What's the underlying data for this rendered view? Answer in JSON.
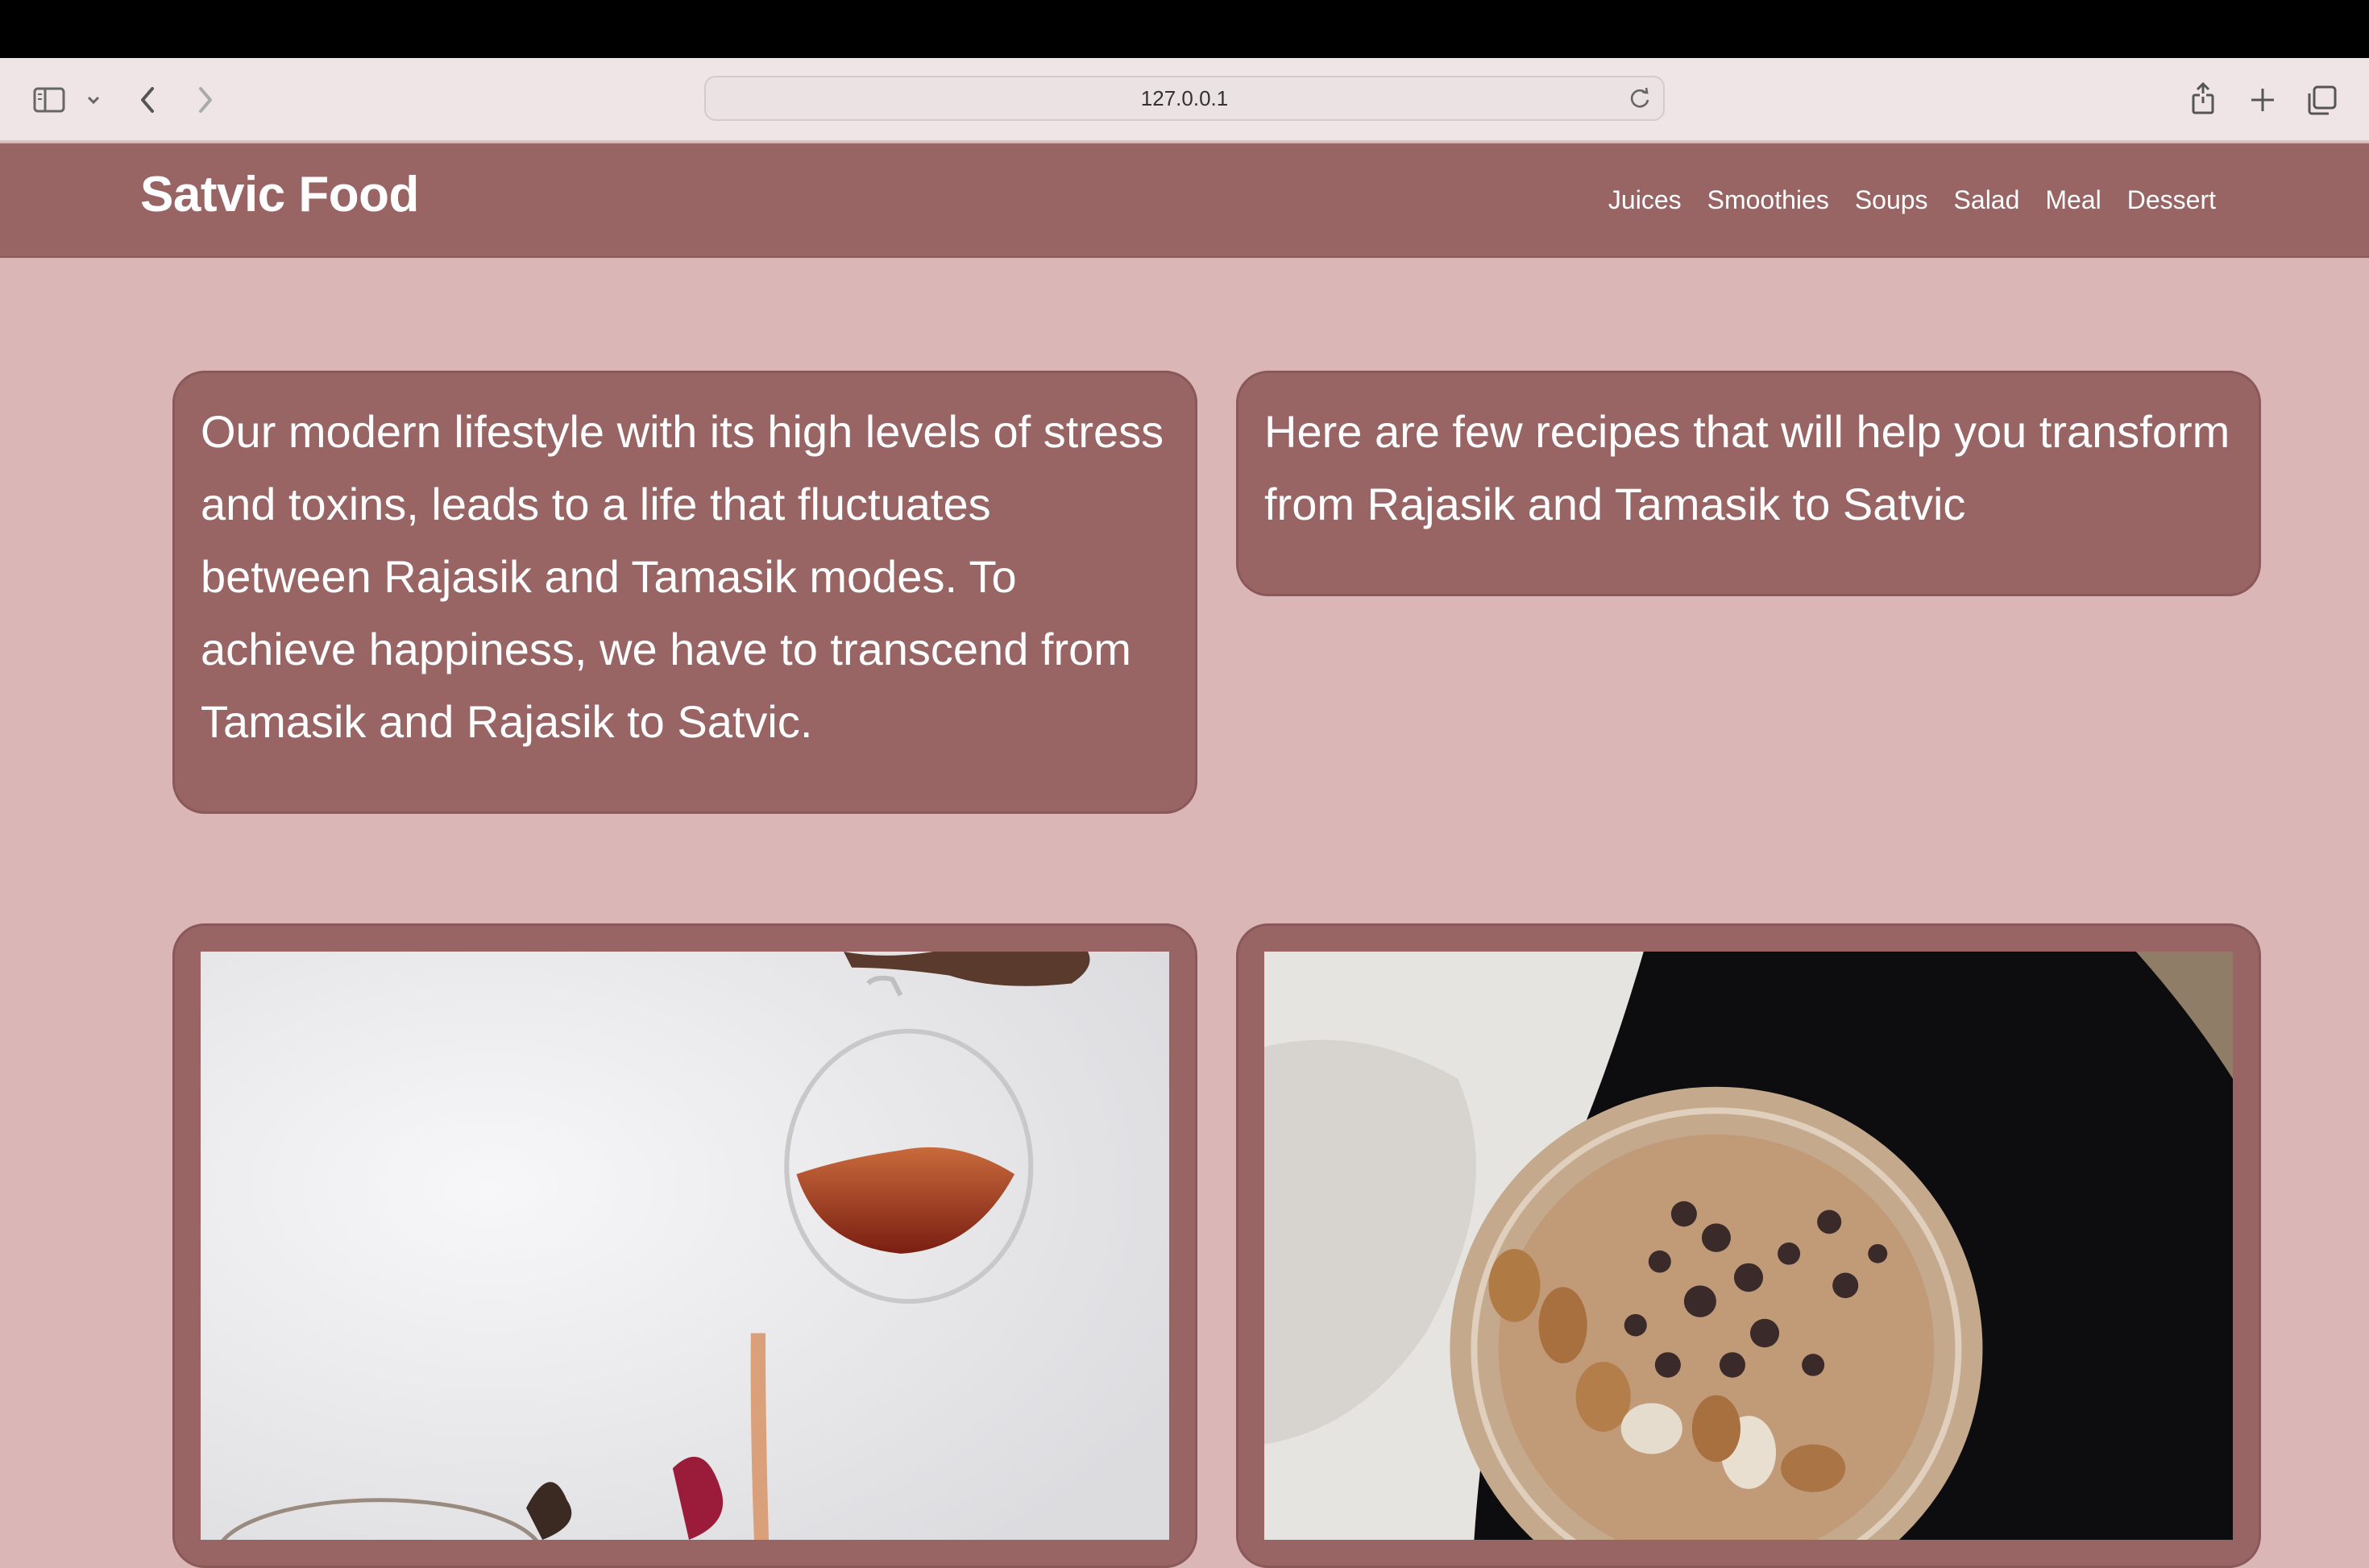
{
  "browser": {
    "url": "127.0.0.1"
  },
  "site": {
    "brand": "Satvic Food",
    "nav": [
      "Juices",
      "Smoothies",
      "Soups",
      "Salad",
      "Meal",
      "Dessert"
    ]
  },
  "intro": {
    "left_text": "Our modern lifestyle with its high levels of stress and toxins, leads to a life that fluctuates between Rajasik and Tamasik modes. To achieve happiness, we have to transcend from Tamasik and Rajasik to Satvic.",
    "right_text": "Here are few recipes that will help you transform from Rajasik and Tamasik to Satvic"
  },
  "colors": {
    "nav_bg": "#986464",
    "page_bg": "#dab6b6",
    "card_bg": "#986464"
  }
}
